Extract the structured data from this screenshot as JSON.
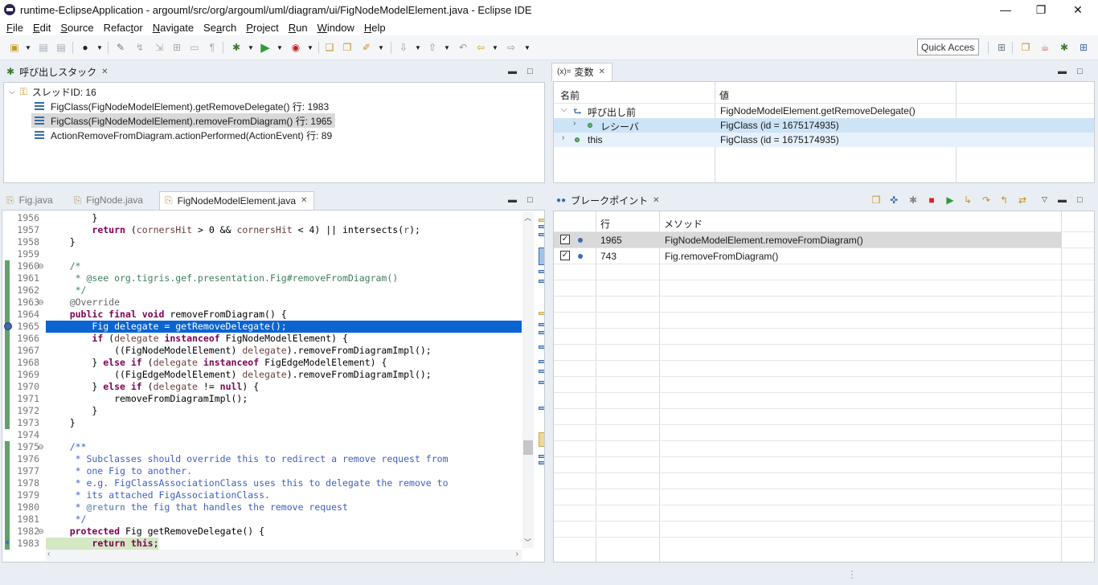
{
  "window": {
    "title": "runtime-EclipseApplication - argouml/src/org/argouml/uml/diagram/ui/FigNodeModelElement.java - Eclipse IDE",
    "minimize": "—",
    "maximize": "❐",
    "close": "✕"
  },
  "menu": [
    {
      "u": "F",
      "rest": "ile"
    },
    {
      "u": "E",
      "rest": "dit"
    },
    {
      "u": "S",
      "rest": "ource"
    },
    {
      "u": "",
      "rest": "Refac",
      "u2": "t",
      "rest2": "or"
    },
    {
      "u": "N",
      "rest": "avigate"
    },
    {
      "u": "",
      "rest": "Se",
      "u2": "a",
      "rest2": "rch"
    },
    {
      "u": "P",
      "rest": "roject"
    },
    {
      "u": "R",
      "rest": "un"
    },
    {
      "u": "W",
      "rest": "indow"
    },
    {
      "u": "H",
      "rest": "elp"
    }
  ],
  "quick_access": "Quick Access",
  "callstack": {
    "tab": "呼び出しスタック",
    "thread": "スレッドID: 16",
    "frames": [
      "FigClass(FigNodeModelElement).getRemoveDelegate() 行: 1983",
      "FigClass(FigNodeModelElement).removeFromDiagram() 行: 1965",
      "ActionRemoveFromDiagram.actionPerformed(ActionEvent) 行: 89"
    ]
  },
  "variables": {
    "tab_prefix": "(x)=",
    "tab": "変数",
    "col_name": "名前",
    "col_value": "値",
    "rows": [
      {
        "name": "呼び出し前",
        "value": "FigNodeModelElement.getRemoveDelegate()"
      },
      {
        "name": "レシーバ",
        "value": "FigClass (id = 1675174935)"
      },
      {
        "name": "this",
        "value": "FigClass (id = 1675174935)"
      }
    ]
  },
  "editor": {
    "tabs": [
      "Fig.java",
      "FigNode.java",
      "FigNodeModelElement.java"
    ],
    "line_numbers": [
      "1956",
      "1957",
      "1958",
      "1959",
      "1960",
      "1961",
      "1962",
      "1963",
      "1964",
      "1965",
      "1966",
      "1967",
      "1968",
      "1969",
      "1970",
      "1971",
      "1972",
      "1973",
      "1974",
      "1975",
      "1976",
      "1977",
      "1978",
      "1979",
      "1980",
      "1981",
      "1982",
      "1983"
    ]
  },
  "breakpoints": {
    "tab": "ブレークポイント",
    "col_line": "行",
    "col_method": "メソッド",
    "rows": [
      {
        "line": "1965",
        "method": "FigNodeModelElement.removeFromDiagram()"
      },
      {
        "line": "743",
        "method": "Fig.removeFromDiagram()"
      }
    ]
  },
  "colors": {
    "selection": "#0a64d2",
    "current_line": "#d4e8c4",
    "keyword": "#7f0055",
    "comment": "#3f7f5f",
    "javadoc": "#3f5fbf"
  }
}
